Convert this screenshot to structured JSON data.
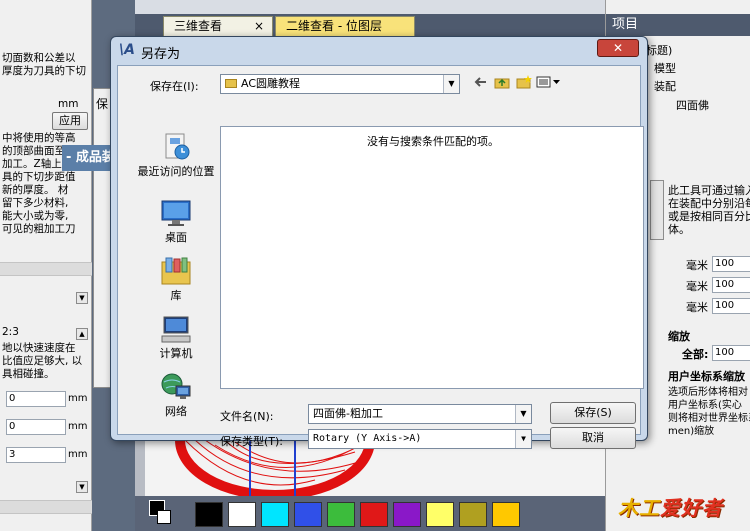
{
  "left_panel": {
    "lines_top": [
      "切面数和公差以",
      "厚度为刀具的下切"
    ],
    "unit_mm": "mm",
    "apply_label": "应用",
    "lines_mid": [
      "中将使用的等高",
      "的顶部曲面至浮",
      "加工。Z轴上的等",
      "具的下切步距值",
      "新的厚度。 材",
      "留下多少材料,",
      "能大小或为零,",
      "可见的粗加工刀"
    ],
    "ratio": "2:3",
    "lines_low": [
      "地以快速速度在",
      "比值应足够大, 以",
      "具相碰撞。"
    ],
    "fields": [
      {
        "value": "0",
        "unit": "mm"
      },
      {
        "value": "0",
        "unit": "mm"
      },
      {
        "value": "3",
        "unit": "mm"
      }
    ]
  },
  "small_dialog": {
    "label": "保"
  },
  "tabs": [
    {
      "label": "三维查看",
      "close": "×"
    },
    {
      "label": "二维查看 - 位图层",
      "close": ""
    }
  ],
  "right_panel": {
    "header": "项目",
    "tree": [
      "标题)",
      "模型",
      "装配",
      "四面佛"
    ],
    "section_title": "- 成品装配向",
    "desc_lines": [
      "此工具可通过输入",
      "在装配中分别沿每",
      "或是按相同百分比",
      "体。"
    ],
    "scale_fields": [
      {
        "label": "毫米",
        "value": "100"
      },
      {
        "label": "毫米",
        "value": "100"
      },
      {
        "label": "毫米",
        "value": "100"
      }
    ],
    "scale_heading": "缩放",
    "all_label": "全部:",
    "all_value": "100",
    "ucs_heading": "用户坐标系缩放",
    "ucs_lines": [
      "选项后形体将相对",
      "用户坐标系(实心",
      "则将相对世界坐标系(",
      "men)缩放"
    ]
  },
  "dialog": {
    "title": "另存为",
    "close_symbol": "✕",
    "save_in_label": "保存在(I):",
    "save_in_value": "AC圆雕教程",
    "empty_message": "没有与搜索条件匹配的项。",
    "places": [
      {
        "label": "最近访问的位置",
        "icon": "recent-places-icon"
      },
      {
        "label": "桌面",
        "icon": "desktop-icon"
      },
      {
        "label": "库",
        "icon": "libraries-icon"
      },
      {
        "label": "计算机",
        "icon": "computer-icon"
      },
      {
        "label": "网络",
        "icon": "network-icon"
      }
    ],
    "filename_label": "文件名(N):",
    "filename_value": "四面佛-粗加工",
    "filetype_label": "保存类型(T):",
    "filetype_value": "Rotary (Y Axis->A)",
    "save_button": "保存(S)",
    "cancel_button": "取消"
  },
  "palette_colors": [
    "#000000",
    "#ffffff",
    "#00e5ff",
    "#3050e8",
    "#3cbc3c",
    "#e01818",
    "#8a18c8",
    "#ffff68",
    "#b0a020",
    "#ffc800"
  ],
  "watermark": {
    "part1": "木工",
    "part2": "爱好者"
  }
}
